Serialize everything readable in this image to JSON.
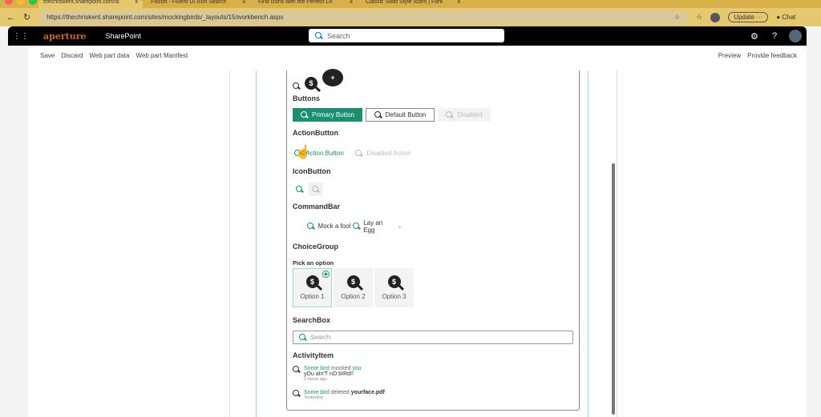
{
  "browser": {
    "tabs": [
      "thechriskent.sharepoint.com/si",
      "Fixcon - Fluent UI Icon Search",
      "Find Icons with the Perfect Lo",
      "Classic Solid Style Icons | Font"
    ],
    "url": "https://thechriskent.sharepoint.com/sites/mockingbirds/_layouts/15/workbench.aspx",
    "update_label": "Update",
    "chat_label": "Chat"
  },
  "header": {
    "logo": "aperture",
    "app": "SharePoint",
    "search_placeholder": "Search"
  },
  "commandbar": {
    "left": [
      "Save",
      "Discard",
      "Web part data",
      "Web part Manifest"
    ],
    "right": [
      "Preview",
      "Provide feedback"
    ]
  },
  "webpart": {
    "buttons_heading": "Buttons",
    "primary": "Primary Button",
    "default": "Default Button",
    "disabled": "Disabled",
    "action_heading": "ActionButton",
    "action": "Action Button",
    "action_disabled": "Disabled Action",
    "icon_heading": "IconButton",
    "commandbar_heading": "CommandBar",
    "cmd1": "Mock a fool",
    "cmd2": "Lay an Egg",
    "choice_heading": "ChoiceGroup",
    "choice_label": "Pick an option",
    "options": [
      "Option 1",
      "Option 2",
      "Option 3"
    ],
    "selected_option": "Option 1",
    "searchbox_heading": "SearchBox",
    "searchbox_placeholder": "Search",
    "activity_heading": "ActivityItem",
    "activities": [
      {
        "actor": "Some bird",
        "verb": "mocked",
        "target": "you",
        "comment": "yOu aIn'T nO bIRd!!",
        "time": "2 hours ago"
      },
      {
        "actor": "Some bird",
        "verb": "deleted",
        "target": "yourface.pdf",
        "time": "Yesterday"
      }
    ]
  },
  "colors": {
    "accent": "#1a9071"
  }
}
